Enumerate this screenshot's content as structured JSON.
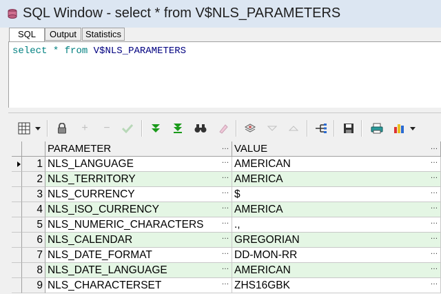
{
  "window": {
    "title": "SQL Window - select * from V$NLS_PARAMETERS"
  },
  "tabs": [
    {
      "label": "SQL",
      "active": true
    },
    {
      "label": "Output",
      "active": false
    },
    {
      "label": "Statistics",
      "active": false
    }
  ],
  "sql": {
    "keyword_select": "select",
    "star": "*",
    "keyword_from": "from",
    "object": "V$NLS_PARAMETERS"
  },
  "colors": {
    "keyword": "#008080",
    "object": "#000080",
    "row_alt": "#e4f6e4",
    "ok_green": "#2aa02a"
  },
  "toolbar": {
    "icons": [
      "grid-icon",
      "dropdown-arrow-icon",
      "lock-icon",
      "insert-record-icon",
      "delete-record-icon",
      "post-changes-icon",
      "fetch-next-icon",
      "fetch-last-icon",
      "find-icon",
      "clear-record-icon",
      "query-by-example-icon",
      "previous-record-icon",
      "next-record-icon",
      "export-icon",
      "save-icon",
      "print-icon",
      "chart-icon",
      "dropdown-arrow-icon"
    ]
  },
  "grid": {
    "columns": [
      "PARAMETER",
      "VALUE"
    ],
    "ellipsis": "…",
    "rows": [
      {
        "num": "1",
        "parameter": "NLS_LANGUAGE",
        "value": "AMERICAN",
        "current": true
      },
      {
        "num": "2",
        "parameter": "NLS_TERRITORY",
        "value": "AMERICA"
      },
      {
        "num": "3",
        "parameter": "NLS_CURRENCY",
        "value": "$"
      },
      {
        "num": "4",
        "parameter": "NLS_ISO_CURRENCY",
        "value": "AMERICA"
      },
      {
        "num": "5",
        "parameter": "NLS_NUMERIC_CHARACTERS",
        "value": ".,"
      },
      {
        "num": "6",
        "parameter": "NLS_CALENDAR",
        "value": "GREGORIAN"
      },
      {
        "num": "7",
        "parameter": "NLS_DATE_FORMAT",
        "value": "DD-MON-RR"
      },
      {
        "num": "8",
        "parameter": "NLS_DATE_LANGUAGE",
        "value": "AMERICAN"
      },
      {
        "num": "9",
        "parameter": "NLS_CHARACTERSET",
        "value": "ZHS16GBK"
      }
    ]
  }
}
